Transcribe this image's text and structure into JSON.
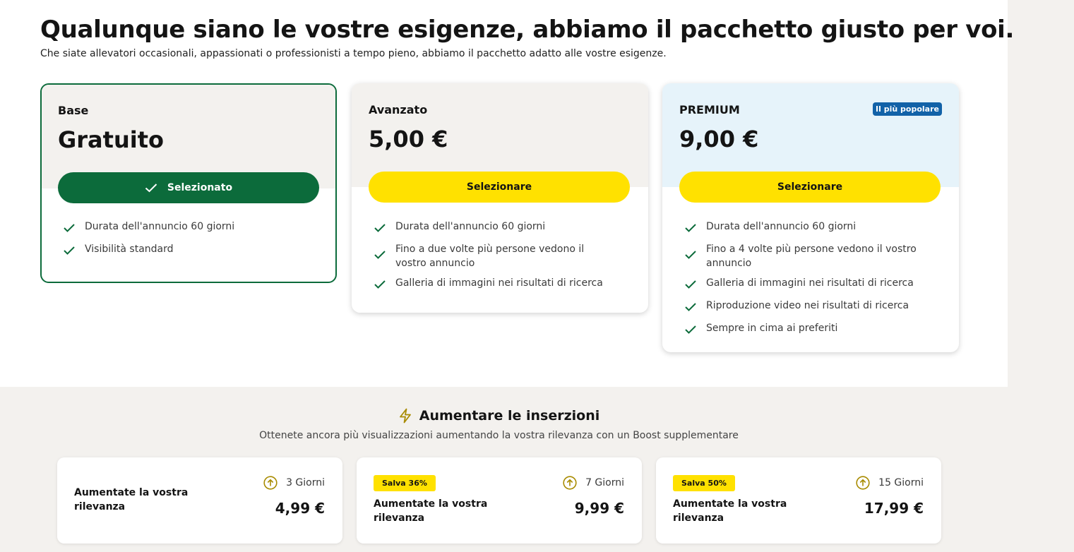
{
  "header": {
    "title": "Qualunque siano le vostre esigenze, abbiamo il pacchetto giusto per voi.",
    "subtitle": "Che siate allevatori occasionali, appassionati o professionisti a tempo pieno, abbiamo il pacchetto adatto alle vostre esigenze."
  },
  "plans": [
    {
      "name": "Base",
      "price": "Gratuito",
      "button": "Selezionato",
      "features": [
        "Durata dell'annuncio 60 giorni",
        "Visibilità standard"
      ]
    },
    {
      "name": "Avanzato",
      "price": "5,00 €",
      "button": "Selezionare",
      "features": [
        "Durata dell'annuncio 60 giorni",
        "Fino a due volte più persone vedono il vostro annuncio",
        "Galleria di immagini nei risultati di ricerca"
      ]
    },
    {
      "name": "PREMIUM",
      "price": "9,00 €",
      "badge": "Il più popolare",
      "button": "Selezionare",
      "features": [
        "Durata dell'annuncio 60 giorni",
        "Fino a 4 volte più persone vedono il vostro annuncio",
        "Galleria di immagini nei risultati di ricerca",
        "Riproduzione video nei risultati di ricerca",
        "Sempre in cima ai preferiti"
      ]
    }
  ],
  "boost": {
    "title": "Aumentare le inserzioni",
    "subtitle": "Ottenete ancora più visualizzazioni aumentando la vostra rilevanza con un Boost supplementare",
    "options": [
      {
        "description": "Aumentate la vostra rilevanza",
        "days": "3 Giorni",
        "price": "4,99 €"
      },
      {
        "badge": "Salva 36%",
        "description": "Aumentate la vostra rilevanza",
        "days": "7 Giorni",
        "price": "9,99 €"
      },
      {
        "badge": "Salva 50%",
        "description": "Aumentate la vostra rilevanza",
        "days": "15 Giorni",
        "price": "17,99 €"
      }
    ]
  },
  "colors": {
    "accent_green": "#0c6b3b",
    "accent_yellow": "#ffe100",
    "premium_bg": "#e6f3fa",
    "neutral_bg": "#f3f1ee",
    "badge_blue": "#1262a8",
    "boost_icon": "#a88b00"
  },
  "icons": {
    "check": "check-icon",
    "bolt": "bolt-icon",
    "arrow_up_circle": "arrow-up-circle-icon"
  }
}
